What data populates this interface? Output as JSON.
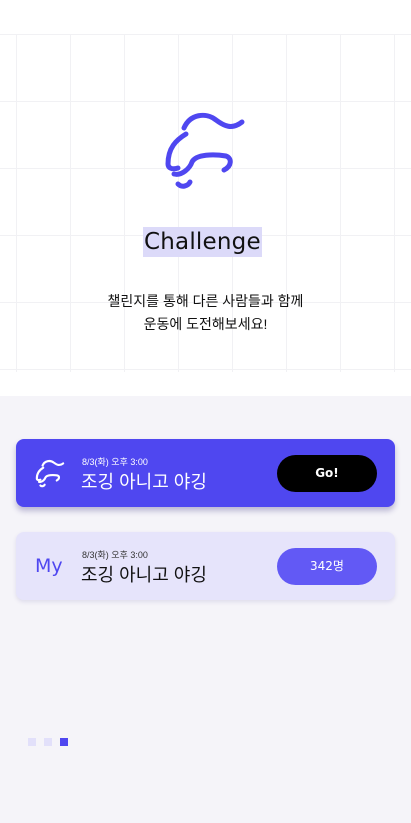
{
  "hero": {
    "title": "Challenge",
    "subtitle_line1": "챌린지를 통해 다른 사람들과 함께",
    "subtitle_line2": "운동에 도전해보세요!",
    "logo_icon": "challenge-logo-icon"
  },
  "cards": {
    "main": {
      "datetime": "8/3(화) 오후 3:00",
      "name": "조깅 아니고 야깅",
      "button_label": "Go!",
      "icon": "challenge-logo-icon"
    },
    "my": {
      "label": "My",
      "datetime": "8/3(화) 오후 3:00",
      "name": "조깅 아니고 야깅",
      "participants": "342명"
    }
  },
  "pagination": {
    "total": 3,
    "active": 3
  },
  "colors": {
    "accent": "#4f47f0",
    "accent_light": "#e6e4fb",
    "background": "#f5f4f9",
    "dot_inactive": "#e2e0fa"
  }
}
